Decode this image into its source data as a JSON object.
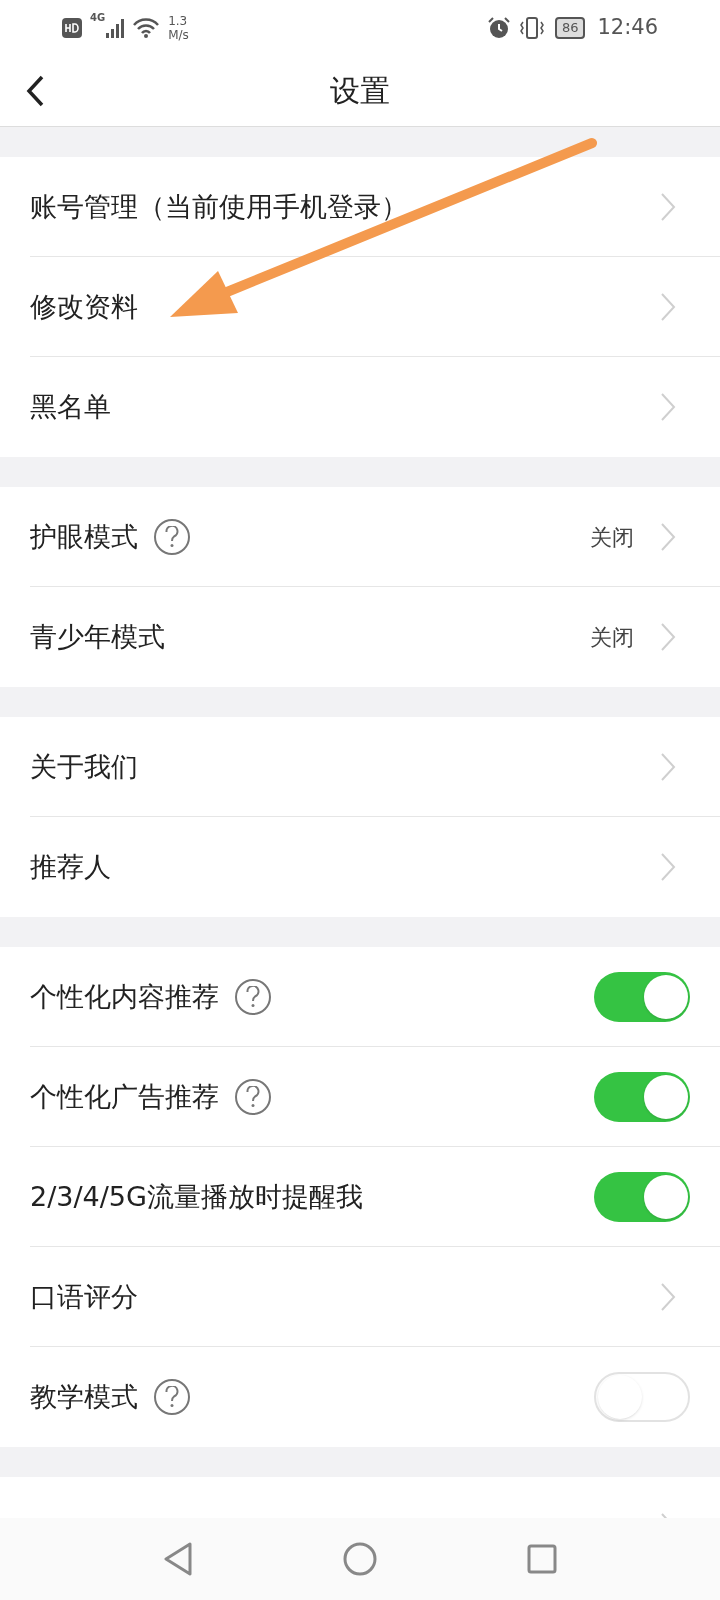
{
  "status_bar": {
    "network": "4G",
    "speed_value": "1.3",
    "speed_unit": "M/s",
    "battery": "86",
    "time": "12:46"
  },
  "header": {
    "title": "设置"
  },
  "groups": [
    {
      "rows": [
        {
          "kind": "link",
          "label": "账号管理（当前使用手机登录）",
          "help": false
        },
        {
          "kind": "link",
          "label": "修改资料",
          "help": false
        },
        {
          "kind": "link",
          "label": "黑名单",
          "help": false
        }
      ]
    },
    {
      "rows": [
        {
          "kind": "link",
          "label": "护眼模式",
          "help": true,
          "value": "关闭"
        },
        {
          "kind": "link",
          "label": "青少年模式",
          "help": false,
          "value": "关闭"
        }
      ]
    },
    {
      "rows": [
        {
          "kind": "link",
          "label": "关于我们",
          "help": false
        },
        {
          "kind": "link",
          "label": "推荐人",
          "help": false
        }
      ]
    },
    {
      "rows": [
        {
          "kind": "toggle",
          "label": "个性化内容推荐",
          "help": true,
          "on": true
        },
        {
          "kind": "toggle",
          "label": "个性化广告推荐",
          "help": true,
          "on": true
        },
        {
          "kind": "toggle",
          "label": "2/3/4/5G流量播放时提醒我",
          "help": false,
          "on": true
        },
        {
          "kind": "link",
          "label": "口语评分",
          "help": false
        },
        {
          "kind": "toggle",
          "label": "教学模式",
          "help": true,
          "on": false
        }
      ]
    },
    {
      "rows": [
        {
          "kind": "link",
          "help": false
        }
      ]
    }
  ]
}
